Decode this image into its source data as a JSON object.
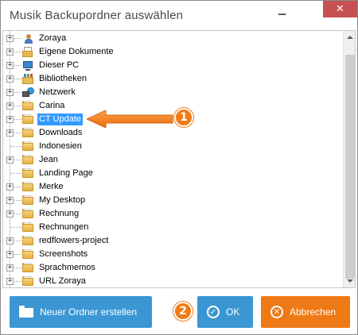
{
  "window": {
    "title": "Musik Backupordner auswählen",
    "minimize_glyph": "▁",
    "close_glyph": "✕"
  },
  "tree": {
    "items": [
      {
        "label": "Zoraya",
        "icon": "user-folder-icon",
        "expandable": true,
        "selected": false
      },
      {
        "label": "Eigene Dokumente",
        "icon": "documents-icon",
        "expandable": true,
        "selected": false
      },
      {
        "label": "Dieser PC",
        "icon": "computer-icon",
        "expandable": true,
        "selected": false
      },
      {
        "label": "Bibliotheken",
        "icon": "libraries-icon",
        "expandable": true,
        "selected": false
      },
      {
        "label": "Netzwerk",
        "icon": "network-icon",
        "expandable": true,
        "selected": false
      },
      {
        "label": "Carina",
        "icon": "folder-icon",
        "expandable": true,
        "selected": false
      },
      {
        "label": "CT Update",
        "icon": "folder-icon",
        "expandable": true,
        "selected": true
      },
      {
        "label": "Downloads",
        "icon": "folder-icon",
        "expandable": true,
        "selected": false
      },
      {
        "label": "Indonesien",
        "icon": "folder-icon",
        "expandable": false,
        "selected": false
      },
      {
        "label": "Jean",
        "icon": "folder-icon",
        "expandable": true,
        "selected": false
      },
      {
        "label": "Landing Page",
        "icon": "folder-icon",
        "expandable": false,
        "selected": false
      },
      {
        "label": "Merke",
        "icon": "folder-icon",
        "expandable": true,
        "selected": false
      },
      {
        "label": "My Desktop",
        "icon": "folder-icon",
        "expandable": true,
        "selected": false
      },
      {
        "label": "Rechnung",
        "icon": "folder-icon",
        "expandable": true,
        "selected": false
      },
      {
        "label": "Rechnungen",
        "icon": "folder-icon",
        "expandable": false,
        "selected": false
      },
      {
        "label": "redflowers-project",
        "icon": "folder-icon",
        "expandable": true,
        "selected": false
      },
      {
        "label": "Screenshots",
        "icon": "folder-icon",
        "expandable": true,
        "selected": false
      },
      {
        "label": "Sprachmemos",
        "icon": "folder-icon",
        "expandable": true,
        "selected": false
      },
      {
        "label": "URL Zoraya",
        "icon": "folder-icon",
        "expandable": true,
        "selected": false
      }
    ],
    "expander_glyph": "+"
  },
  "annotations": {
    "badge_1": "1",
    "badge_2": "2",
    "accent_color": "#f07c17"
  },
  "buttons": {
    "new_folder": "Neuer Ordner erstellen",
    "ok": "OK",
    "cancel": "Abbrechen",
    "ok_glyph": "✓",
    "cancel_glyph": "✕",
    "primary_color": "#3b97d3",
    "cancel_color": "#ee7a15"
  }
}
